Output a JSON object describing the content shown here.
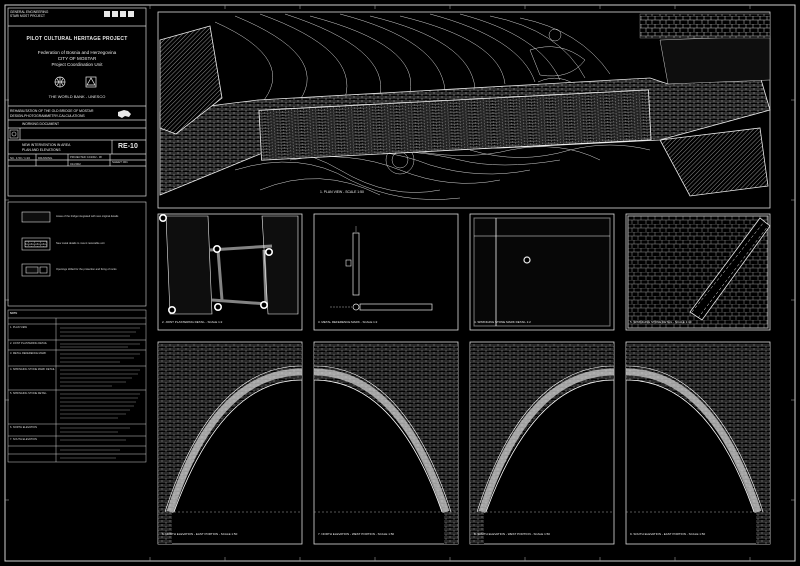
{
  "header": {
    "top_lines": [
      "GENERAL ENGINEERING",
      "STARI MOST PROJECT"
    ],
    "project": "PILOT CULTURAL HERITAGE PROJECT",
    "org_lines": [
      "Federation of Bosnia and Herzegovina",
      "CITY OF MOSTAR",
      "Project Coordination Unit"
    ],
    "sponsor": "THE WORLD BANK - UNESCO",
    "block_title": [
      "REHABILITATION OF THE OLD BRIDGE OF MOSTAR",
      "DESIGN-PHOTOGRAMMETRY-CALCULATIONS"
    ],
    "doc_type": "WORKING DOCUMENT",
    "sheet_title": [
      "NEW INTERVENTION IN AREA",
      "PLAN AND ELEVATIONS"
    ],
    "sheet_code": "RE-10",
    "scale_row": [
      "SC. 1:50 / 1:20",
      "DRAWING",
      "PROJECTED: 10/2002 - 08",
      "01/2002",
      "SHEET 001"
    ]
  },
  "legend": {
    "items": [
      {
        "swatch": "stone-texture",
        "text": "Areas of the bridge integrated with new original details"
      },
      {
        "swatch": "framed-detail",
        "text": "New metal details to mount restorable unit"
      },
      {
        "swatch": "survey-detail",
        "text": "Openings drilled for the protection and fixing of rocks"
      }
    ]
  },
  "notes": {
    "header": "NOTE",
    "rows": [
      "1. PLAN VIEW",
      "2. JOINT PLASTERING DETAIL",
      "3. METAL REFERENCE MARK",
      "4. SPRINGING STONE MARK DETAIL",
      "5. SPRINGING STONE DETAIL",
      "6. NORTH ELEVATION",
      "7. SOUTH ELEVATION"
    ]
  },
  "views": {
    "plan": "1.  PLAN VIEW  -  SCALE 1:50",
    "d2": "2.  JOINT PLASTERING DETAIL  -  SCALE 1:2",
    "d3": "3.  METAL REFERENCE MARK  -  SCALE 1:2",
    "d4": "4.  SPRINGING STONE MARK DETAIL 1:2",
    "d5": "5.  SPRINGING STONE DETAIL  -  SCALE 1:10",
    "e6": "6.  NORTH ELEVATION - EAST PORTION  -  SCALE 1:50",
    "e7": "7.  NORTH ELEVATION - WEST PORTION  -  SCALE 1:50",
    "e8": "8.  SOUTH ELEVATION - WEST PORTION  -  SCALE 1:50",
    "e9": "9.  SOUTH ELEVATION - EAST PORTION  -  SCALE 1:50"
  },
  "colors": {
    "background": "#000000",
    "line": "#ffffff"
  }
}
